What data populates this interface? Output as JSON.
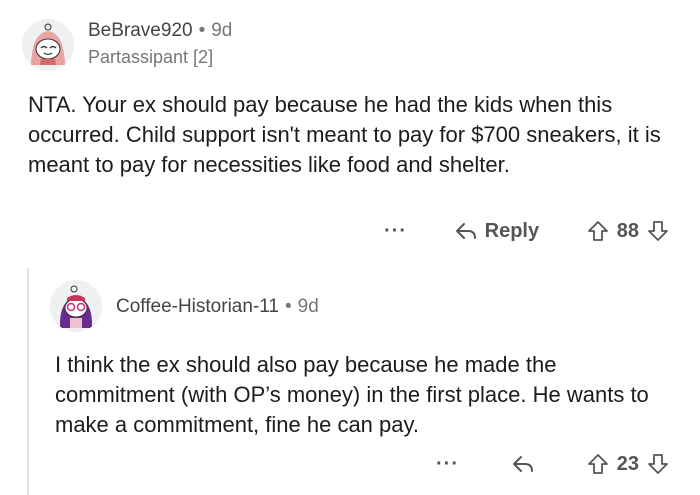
{
  "comment": {
    "username": "BeBrave920",
    "time": "9d",
    "flair": "Partassipant [2]",
    "body": "NTA. Your ex should pay because he had the kids when this occurred. Child support isn't meant to pay for $700 sneakers, it is meant to pay for necessities like food and shelter.",
    "more": "···",
    "reply_label": "Reply",
    "score": "88"
  },
  "reply": {
    "username": "Coffee-Historian-11",
    "time": "9d",
    "body": "I think the ex should also pay because he made the commitment (with OP’s money) in the first place. He wants to make a commitment, fine he can pay.",
    "more": "···",
    "score": "23"
  },
  "separator": "•",
  "icons": {
    "reply": "reply-arrow-icon",
    "upvote": "upvote-arrow-icon",
    "downvote": "downvote-arrow-icon",
    "avatar1": "snoo-avatar-pink-hood",
    "avatar2": "snoo-avatar-purple-hair"
  }
}
